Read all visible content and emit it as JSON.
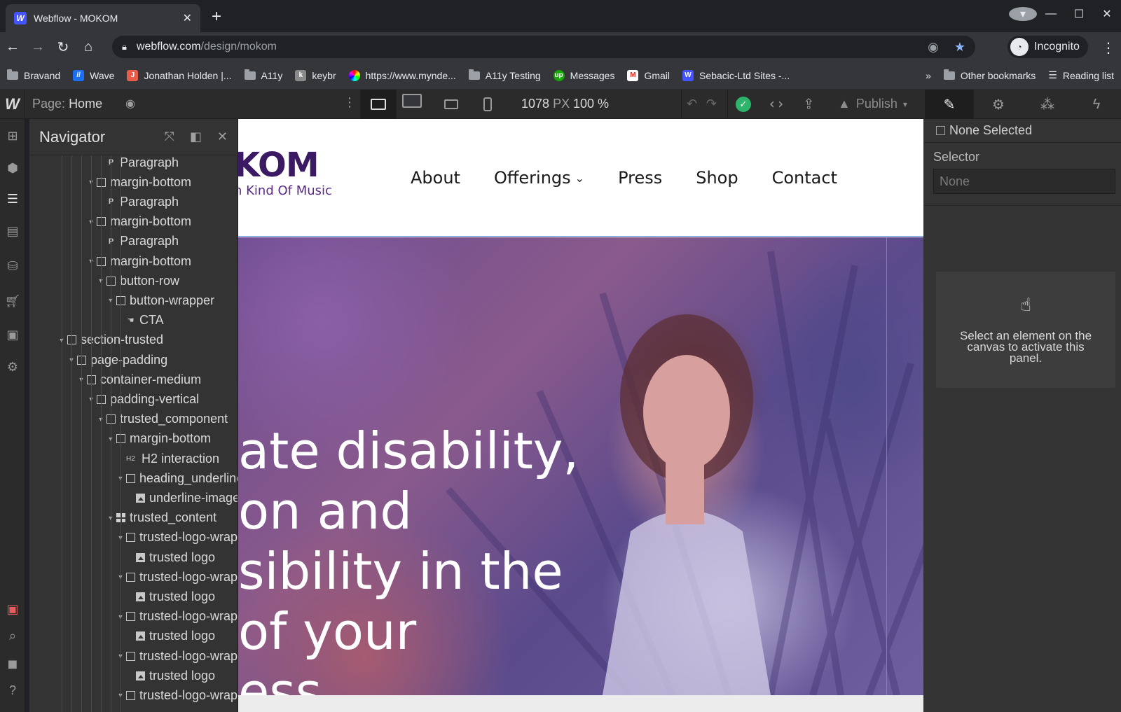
{
  "browser": {
    "tab_title": "Webflow - MOKOM",
    "tab_favicon": "W",
    "url_host": "webflow.com",
    "url_path": "/design/mokom",
    "profile_label": "Incognito",
    "bookmarks": [
      {
        "label": "Bravand",
        "icon": "folder-icon"
      },
      {
        "label": "Wave",
        "icon": "wave-icon",
        "color": "#1c6ef2"
      },
      {
        "label": "Jonathan Holden |...",
        "icon": "jh-icon",
        "color": "#e85d4a"
      },
      {
        "label": "A11y",
        "icon": "folder-icon"
      },
      {
        "label": "keybr",
        "icon": "keybr-icon",
        "color": "#8a8a8a"
      },
      {
        "label": "https://www.mynde...",
        "icon": "color-wheel-icon",
        "color": "#c83ac8"
      },
      {
        "label": "A11y Testing",
        "icon": "folder-icon"
      },
      {
        "label": "Messages",
        "icon": "upwork-icon",
        "color": "#14a800"
      },
      {
        "label": "Gmail",
        "icon": "gmail-icon",
        "color": "#d93025"
      },
      {
        "label": "Sebacic-Ltd Sites -...",
        "icon": "webflow-icon",
        "color": "#4353ff"
      }
    ],
    "bookmarks_overflow": "»",
    "other_bookmarks": "Other bookmarks",
    "reading_list": "Reading list"
  },
  "designer": {
    "page_prefix": "Page:",
    "page_name": "Home",
    "width_value": "1078",
    "width_unit": "PX",
    "zoom": "100 %",
    "publish_label": "Publish"
  },
  "navigator": {
    "title": "Navigator",
    "items": [
      {
        "label": "Paragraph",
        "type": "paragraph",
        "depth": 4,
        "caret": false
      },
      {
        "label": "margin-bottom",
        "type": "box",
        "depth": 3,
        "caret": true
      },
      {
        "label": "Paragraph",
        "type": "paragraph",
        "depth": 4,
        "caret": false
      },
      {
        "label": "margin-bottom",
        "type": "box",
        "depth": 3,
        "caret": true
      },
      {
        "label": "Paragraph",
        "type": "paragraph",
        "depth": 4,
        "caret": false
      },
      {
        "label": "margin-bottom",
        "type": "box",
        "depth": 3,
        "caret": true
      },
      {
        "label": "button-row",
        "type": "box",
        "depth": 4,
        "caret": true
      },
      {
        "label": "button-wrapper",
        "type": "box",
        "depth": 5,
        "caret": true
      },
      {
        "label": "CTA",
        "type": "link",
        "depth": 6,
        "caret": false
      },
      {
        "label": "section-trusted",
        "type": "box",
        "depth": 0,
        "caret": true
      },
      {
        "label": "page-padding",
        "type": "box",
        "depth": 1,
        "caret": true
      },
      {
        "label": "container-medium",
        "type": "box",
        "depth": 2,
        "caret": true
      },
      {
        "label": "padding-vertical",
        "type": "box",
        "depth": 3,
        "caret": true
      },
      {
        "label": "trusted_component",
        "type": "box",
        "depth": 4,
        "caret": true
      },
      {
        "label": "margin-bottom",
        "type": "box",
        "depth": 5,
        "caret": true
      },
      {
        "label": "H2 interaction",
        "type": "h2",
        "depth": 6,
        "caret": false
      },
      {
        "label": "heading_underline",
        "type": "box",
        "depth": 6,
        "caret": true
      },
      {
        "label": "underline-image",
        "type": "image",
        "depth": 7,
        "caret": false
      },
      {
        "label": "trusted_content",
        "type": "grid",
        "depth": 5,
        "caret": true
      },
      {
        "label": "trusted-logo-wrapper",
        "type": "box",
        "depth": 6,
        "caret": true
      },
      {
        "label": "trusted logo",
        "type": "image",
        "depth": 7,
        "caret": false
      },
      {
        "label": "trusted-logo-wrapper",
        "type": "box",
        "depth": 6,
        "caret": true
      },
      {
        "label": "trusted logo",
        "type": "image",
        "depth": 7,
        "caret": false
      },
      {
        "label": "trusted-logo-wrapper",
        "type": "box",
        "depth": 6,
        "caret": true
      },
      {
        "label": "trusted logo",
        "type": "image",
        "depth": 7,
        "caret": false
      },
      {
        "label": "trusted-logo-wrapper",
        "type": "box",
        "depth": 6,
        "caret": true
      },
      {
        "label": "trusted logo",
        "type": "image",
        "depth": 7,
        "caret": false
      },
      {
        "label": "trusted-logo-wrapper",
        "type": "box",
        "depth": 6,
        "caret": true
      }
    ]
  },
  "site": {
    "brand_name": "KOM",
    "brand_tag": "n Kind Of Music",
    "brand_color": "#3b1a63",
    "menu": [
      "About",
      "Offerings",
      "Press",
      "Shop",
      "Contact"
    ],
    "hero_lines": [
      "ate disability,",
      "on and",
      "sibility in the",
      "of your",
      "ess"
    ]
  },
  "style_panel": {
    "selection": "None Selected",
    "selector_label": "Selector",
    "selector_placeholder": "None",
    "empty_message": "Select an element on the canvas to activate this panel."
  }
}
